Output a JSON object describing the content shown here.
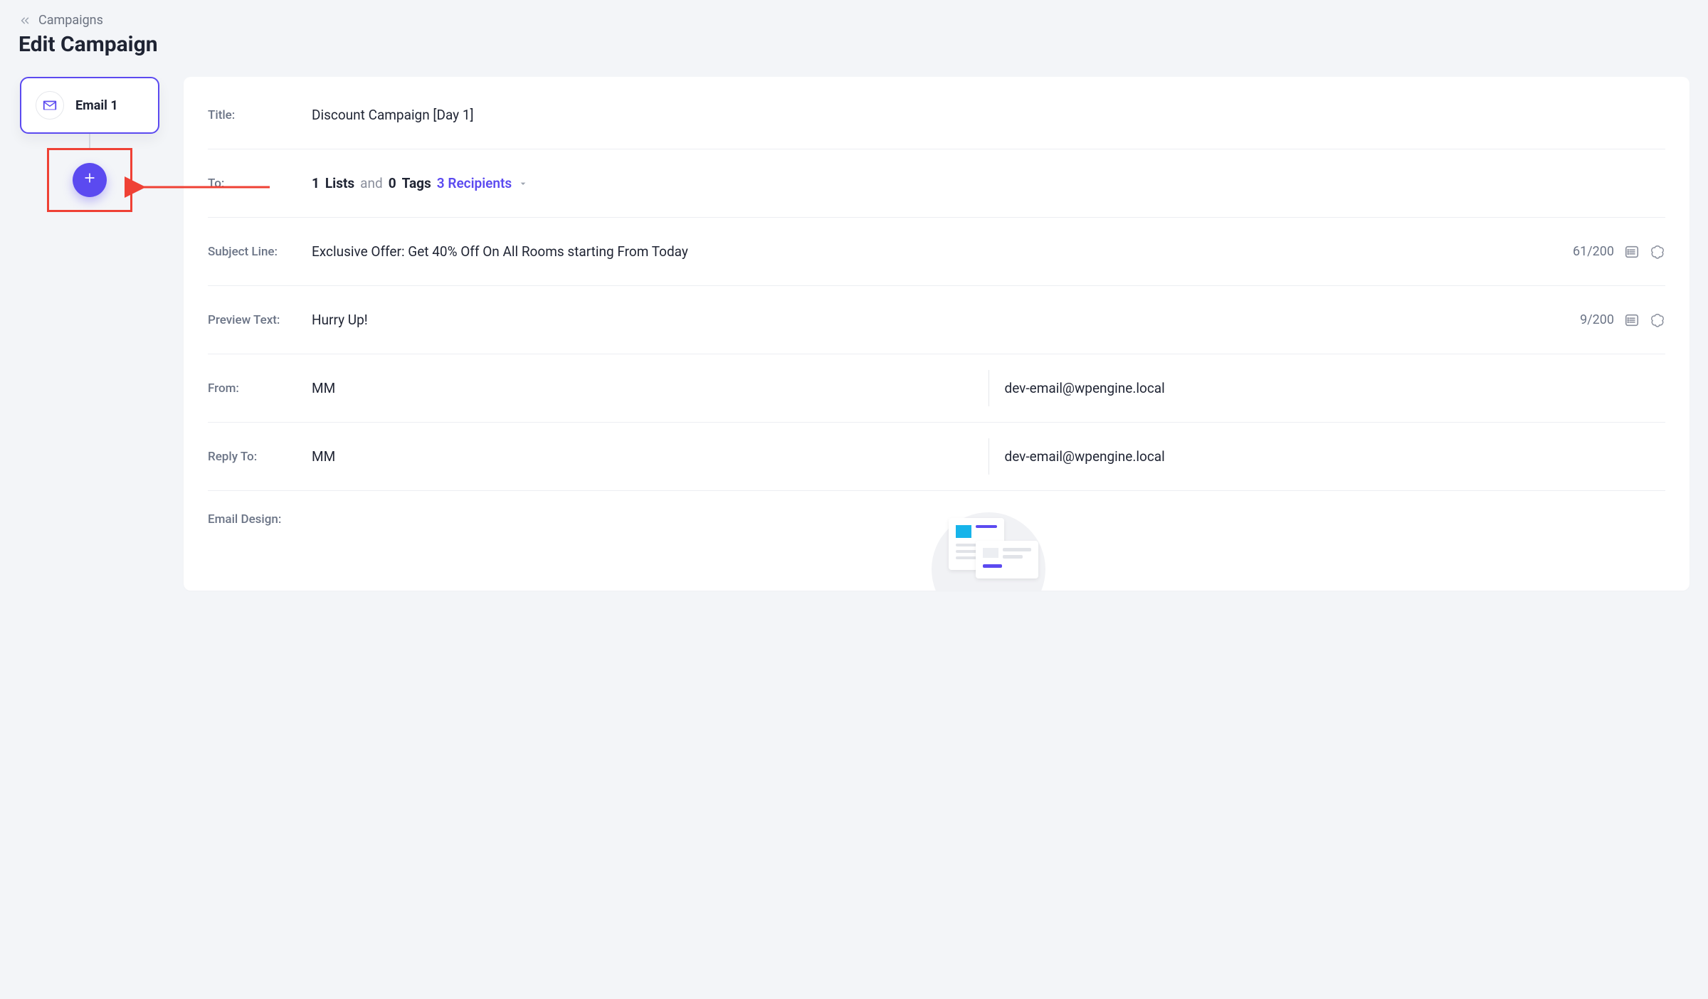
{
  "breadcrumb": {
    "label": "Campaigns"
  },
  "page_title": "Edit Campaign",
  "sidebar": {
    "email_card_label": "Email 1"
  },
  "fields": {
    "title_label": "Title:",
    "title_value": "Discount Campaign [Day 1]",
    "to_label": "To:",
    "to_lists_count": "1",
    "to_lists_word": "Lists",
    "to_and": "and",
    "to_tags_count": "0",
    "to_tags_word": "Tags",
    "to_recipients": "3 Recipients",
    "subject_label": "Subject Line:",
    "subject_value": "Exclusive Offer: Get 40% Off On All Rooms starting From Today",
    "subject_counter": "61/200",
    "preview_label": "Preview Text:",
    "preview_value": "Hurry Up!",
    "preview_counter": "9/200",
    "from_label": "From:",
    "from_name": "MM",
    "from_email": "dev-email@wpengine.local",
    "reply_label": "Reply To:",
    "reply_name": "MM",
    "reply_email": "dev-email@wpengine.local",
    "design_label": "Email Design:"
  }
}
